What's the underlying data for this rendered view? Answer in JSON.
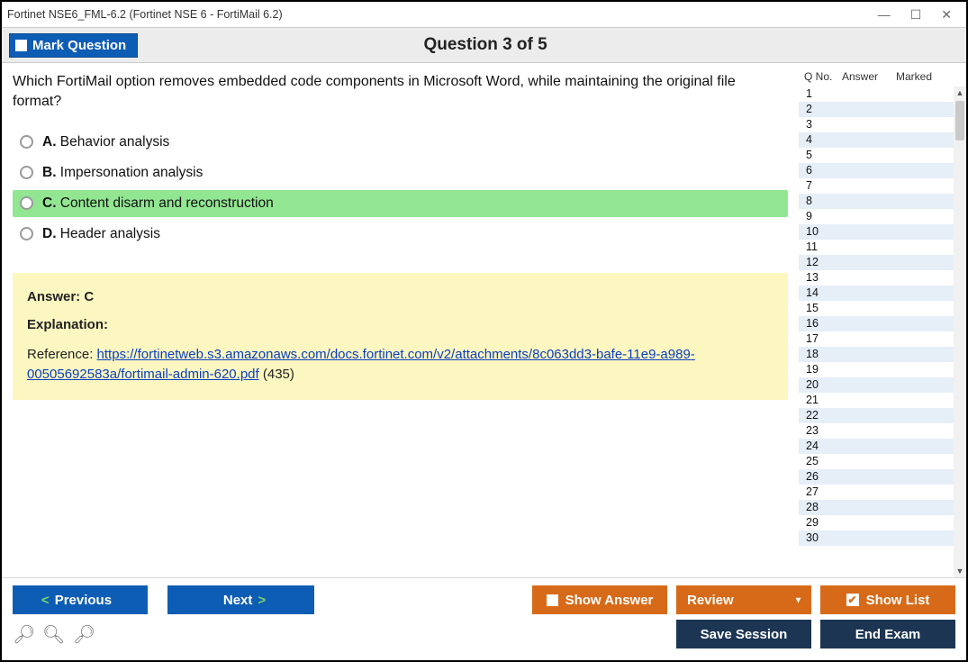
{
  "window_title": "Fortinet NSE6_FML-6.2 (Fortinet NSE 6 - FortiMail 6.2)",
  "header": {
    "mark_label": "Mark Question",
    "question_counter": "Question 3 of 5"
  },
  "question": {
    "text": "Which FortiMail option removes embedded code components in Microsoft Word, while maintaining the original file format?",
    "options": [
      {
        "letter": "A.",
        "text": "Behavior analysis",
        "selected": false
      },
      {
        "letter": "B.",
        "text": "Impersonation analysis",
        "selected": false
      },
      {
        "letter": "C.",
        "text": "Content disarm and reconstruction",
        "selected": true
      },
      {
        "letter": "D.",
        "text": "Header analysis",
        "selected": false
      }
    ]
  },
  "answer": {
    "correct_label": "Answer: C",
    "explanation_label": "Explanation:",
    "reference_prefix": "Reference: ",
    "reference_link": "https://fortinetweb.s3.amazonaws.com/docs.fortinet.com/v2/attachments/8c063dd3-bafe-11e9-a989-00505692583a/fortimail-admin-620.pdf",
    "reference_suffix": " (435)"
  },
  "sidebar": {
    "col1": "Q No.",
    "col2": "Answer",
    "col3": "Marked",
    "rows": [
      1,
      2,
      3,
      4,
      5,
      6,
      7,
      8,
      9,
      10,
      11,
      12,
      13,
      14,
      15,
      16,
      17,
      18,
      19,
      20,
      21,
      22,
      23,
      24,
      25,
      26,
      27,
      28,
      29,
      30
    ]
  },
  "footer": {
    "previous": "Previous",
    "next": "Next",
    "show_answer": "Show Answer",
    "review": "Review",
    "show_list": "Show List",
    "save_session": "Save Session",
    "end_exam": "End Exam"
  }
}
